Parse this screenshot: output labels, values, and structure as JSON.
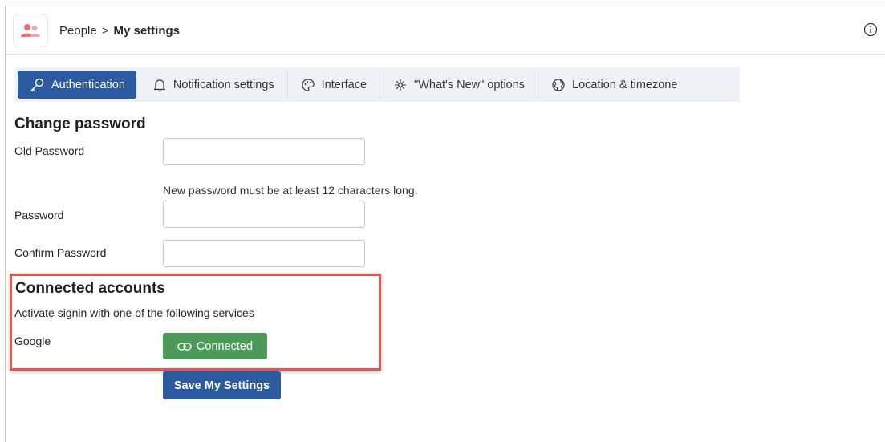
{
  "header": {
    "breadcrumb_parent": "People",
    "breadcrumb_separator": ">",
    "breadcrumb_current": "My settings",
    "app_icon": "people-icon",
    "brand_color": "#e5707c"
  },
  "tabs": [
    {
      "label": "Authentication",
      "icon": "key-icon",
      "active": true
    },
    {
      "label": "Notification settings",
      "icon": "bell-icon",
      "active": false
    },
    {
      "label": "Interface",
      "icon": "palette-icon",
      "active": false
    },
    {
      "label": "\"What's New\" options",
      "icon": "sparkle-icon",
      "active": false
    },
    {
      "label": "Location & timezone",
      "icon": "globe-icon",
      "active": false
    }
  ],
  "change_password": {
    "title": "Change password",
    "old_password_label": "Old Password",
    "old_password_value": "",
    "hint": "New password must be at least 12 characters long.",
    "password_label": "Password",
    "password_value": "",
    "confirm_label": "Confirm Password",
    "confirm_value": ""
  },
  "connected_accounts": {
    "title": "Connected accounts",
    "subtitle": "Activate signin with one of the following services",
    "google_label": "Google",
    "google_button": "Connected",
    "google_button_icon": "link-icon",
    "highlight_color": "#e2574c"
  },
  "save_button": "Save My Settings",
  "colors": {
    "primary": "#2c5aa0",
    "success": "#4c9a5a",
    "tab_bar_bg": "#eef1f5"
  }
}
